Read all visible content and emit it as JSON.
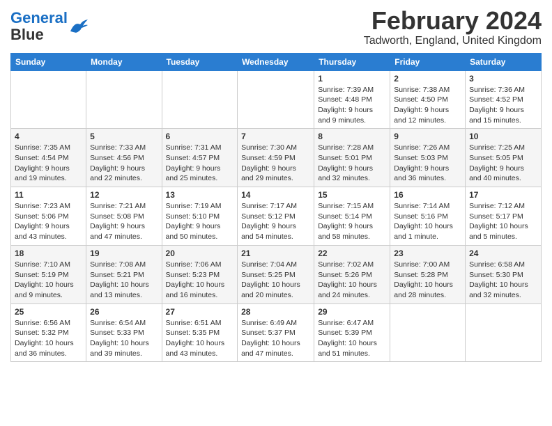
{
  "header": {
    "logo_line1": "General",
    "logo_line2": "Blue",
    "month_title": "February 2024",
    "location": "Tadworth, England, United Kingdom"
  },
  "weekdays": [
    "Sunday",
    "Monday",
    "Tuesday",
    "Wednesday",
    "Thursday",
    "Friday",
    "Saturday"
  ],
  "weeks": [
    [
      {
        "day": "",
        "info": ""
      },
      {
        "day": "",
        "info": ""
      },
      {
        "day": "",
        "info": ""
      },
      {
        "day": "",
        "info": ""
      },
      {
        "day": "1",
        "info": "Sunrise: 7:39 AM\nSunset: 4:48 PM\nDaylight: 9 hours\nand 9 minutes."
      },
      {
        "day": "2",
        "info": "Sunrise: 7:38 AM\nSunset: 4:50 PM\nDaylight: 9 hours\nand 12 minutes."
      },
      {
        "day": "3",
        "info": "Sunrise: 7:36 AM\nSunset: 4:52 PM\nDaylight: 9 hours\nand 15 minutes."
      }
    ],
    [
      {
        "day": "4",
        "info": "Sunrise: 7:35 AM\nSunset: 4:54 PM\nDaylight: 9 hours\nand 19 minutes."
      },
      {
        "day": "5",
        "info": "Sunrise: 7:33 AM\nSunset: 4:56 PM\nDaylight: 9 hours\nand 22 minutes."
      },
      {
        "day": "6",
        "info": "Sunrise: 7:31 AM\nSunset: 4:57 PM\nDaylight: 9 hours\nand 25 minutes."
      },
      {
        "day": "7",
        "info": "Sunrise: 7:30 AM\nSunset: 4:59 PM\nDaylight: 9 hours\nand 29 minutes."
      },
      {
        "day": "8",
        "info": "Sunrise: 7:28 AM\nSunset: 5:01 PM\nDaylight: 9 hours\nand 32 minutes."
      },
      {
        "day": "9",
        "info": "Sunrise: 7:26 AM\nSunset: 5:03 PM\nDaylight: 9 hours\nand 36 minutes."
      },
      {
        "day": "10",
        "info": "Sunrise: 7:25 AM\nSunset: 5:05 PM\nDaylight: 9 hours\nand 40 minutes."
      }
    ],
    [
      {
        "day": "11",
        "info": "Sunrise: 7:23 AM\nSunset: 5:06 PM\nDaylight: 9 hours\nand 43 minutes."
      },
      {
        "day": "12",
        "info": "Sunrise: 7:21 AM\nSunset: 5:08 PM\nDaylight: 9 hours\nand 47 minutes."
      },
      {
        "day": "13",
        "info": "Sunrise: 7:19 AM\nSunset: 5:10 PM\nDaylight: 9 hours\nand 50 minutes."
      },
      {
        "day": "14",
        "info": "Sunrise: 7:17 AM\nSunset: 5:12 PM\nDaylight: 9 hours\nand 54 minutes."
      },
      {
        "day": "15",
        "info": "Sunrise: 7:15 AM\nSunset: 5:14 PM\nDaylight: 9 hours\nand 58 minutes."
      },
      {
        "day": "16",
        "info": "Sunrise: 7:14 AM\nSunset: 5:16 PM\nDaylight: 10 hours\nand 1 minute."
      },
      {
        "day": "17",
        "info": "Sunrise: 7:12 AM\nSunset: 5:17 PM\nDaylight: 10 hours\nand 5 minutes."
      }
    ],
    [
      {
        "day": "18",
        "info": "Sunrise: 7:10 AM\nSunset: 5:19 PM\nDaylight: 10 hours\nand 9 minutes."
      },
      {
        "day": "19",
        "info": "Sunrise: 7:08 AM\nSunset: 5:21 PM\nDaylight: 10 hours\nand 13 minutes."
      },
      {
        "day": "20",
        "info": "Sunrise: 7:06 AM\nSunset: 5:23 PM\nDaylight: 10 hours\nand 16 minutes."
      },
      {
        "day": "21",
        "info": "Sunrise: 7:04 AM\nSunset: 5:25 PM\nDaylight: 10 hours\nand 20 minutes."
      },
      {
        "day": "22",
        "info": "Sunrise: 7:02 AM\nSunset: 5:26 PM\nDaylight: 10 hours\nand 24 minutes."
      },
      {
        "day": "23",
        "info": "Sunrise: 7:00 AM\nSunset: 5:28 PM\nDaylight: 10 hours\nand 28 minutes."
      },
      {
        "day": "24",
        "info": "Sunrise: 6:58 AM\nSunset: 5:30 PM\nDaylight: 10 hours\nand 32 minutes."
      }
    ],
    [
      {
        "day": "25",
        "info": "Sunrise: 6:56 AM\nSunset: 5:32 PM\nDaylight: 10 hours\nand 36 minutes."
      },
      {
        "day": "26",
        "info": "Sunrise: 6:54 AM\nSunset: 5:33 PM\nDaylight: 10 hours\nand 39 minutes."
      },
      {
        "day": "27",
        "info": "Sunrise: 6:51 AM\nSunset: 5:35 PM\nDaylight: 10 hours\nand 43 minutes."
      },
      {
        "day": "28",
        "info": "Sunrise: 6:49 AM\nSunset: 5:37 PM\nDaylight: 10 hours\nand 47 minutes."
      },
      {
        "day": "29",
        "info": "Sunrise: 6:47 AM\nSunset: 5:39 PM\nDaylight: 10 hours\nand 51 minutes."
      },
      {
        "day": "",
        "info": ""
      },
      {
        "day": "",
        "info": ""
      }
    ]
  ]
}
